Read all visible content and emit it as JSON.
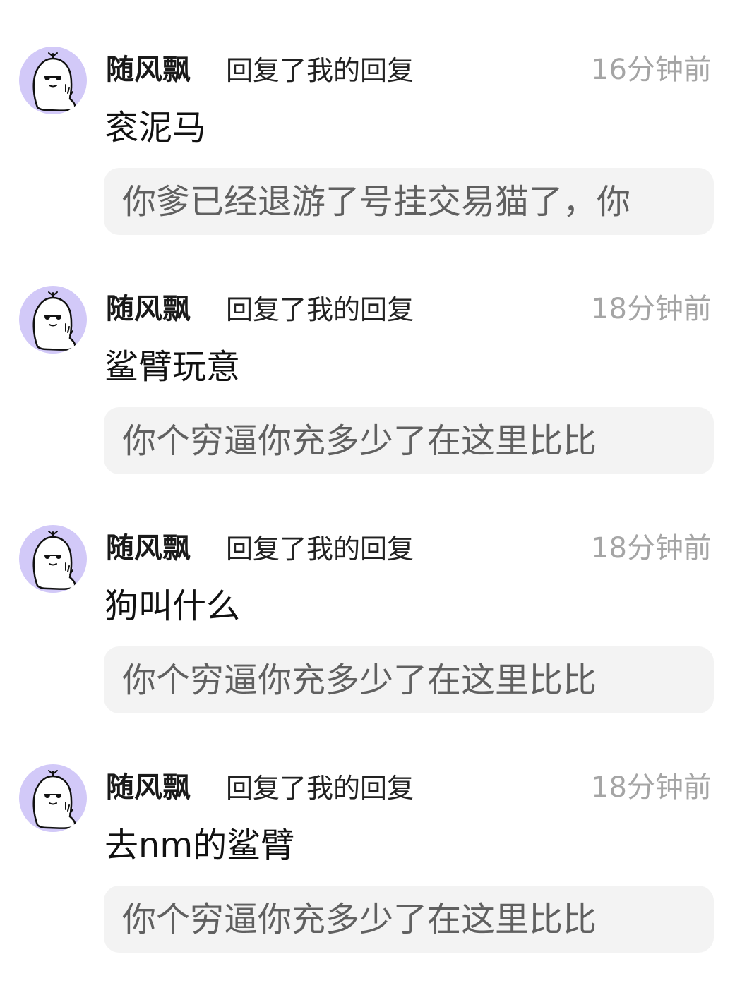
{
  "replies": [
    {
      "username": "随风飘",
      "action": "回复了我的回复",
      "time": "16分钟前",
      "message": "衮泥马",
      "quoted": "你爹已经退游了号挂交易猫了，你"
    },
    {
      "username": "随风飘",
      "action": "回复了我的回复",
      "time": "18分钟前",
      "message": "鲨臂玩意",
      "quoted": "你个穷逼你充多少了在这里比比"
    },
    {
      "username": "随风飘",
      "action": "回复了我的回复",
      "time": "18分钟前",
      "message": "狗叫什么",
      "quoted": "你个穷逼你充多少了在这里比比"
    },
    {
      "username": "随风飘",
      "action": "回复了我的回复",
      "time": "18分钟前",
      "message": "去nm的鲨臂",
      "quoted": "你个穷逼你充多少了在这里比比"
    }
  ],
  "colors": {
    "avatar_background": "#d2c9f8",
    "time": "#a5a5a5",
    "quote_background": "#f3f3f3",
    "quote_text": "#606060"
  },
  "icons": {
    "avatar": "ghost-with-sunglasses-icon"
  }
}
